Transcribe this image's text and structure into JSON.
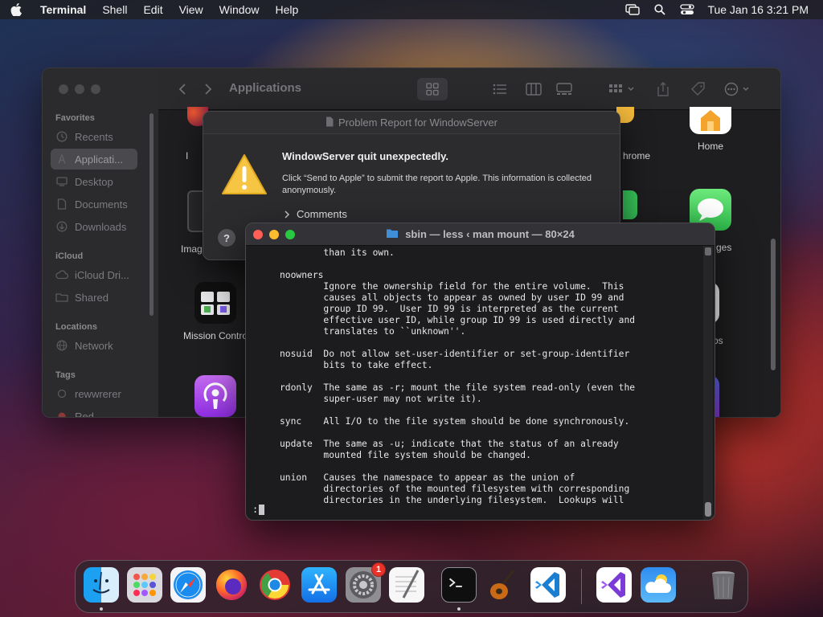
{
  "menubar": {
    "app_name": "Terminal",
    "items": [
      "Shell",
      "Edit",
      "View",
      "Window",
      "Help"
    ],
    "clock": "Tue Jan 16  3:21 PM"
  },
  "finder": {
    "title": "Applications",
    "sidebar": {
      "favorites_header": "Favorites",
      "favorites": [
        "Recents",
        "Applicati...",
        "Desktop",
        "Documents",
        "Downloads"
      ],
      "icloud_header": "iCloud",
      "icloud": [
        "iCloud Dri...",
        "Shared"
      ],
      "locations_header": "Locations",
      "locations": [
        "Network"
      ],
      "tags_header": "Tags",
      "tags": [
        "rewwrerer",
        "Red"
      ]
    },
    "apps": {
      "home": "Home",
      "chrome_partial": "hrome",
      "image_partial": "Imag",
      "messages_partial": "ges",
      "mission_control": "Mission Contro",
      "photos_partial": "os",
      "i_partial": "I"
    }
  },
  "report": {
    "title": "Problem Report for WindowServer",
    "heading": "WindowServer quit unexpectedly.",
    "body": "Click “Send to Apple” to submit the report to Apple. This information is collected anonymously.",
    "comments": "Comments",
    "help": "?"
  },
  "terminal": {
    "title": "sbin — less ‹ man mount — 80×24",
    "lines": [
      "             than its own.",
      "",
      "     noowners",
      "             Ignore the ownership field for the entire volume.  This",
      "             causes all objects to appear as owned by user ID 99 and",
      "             group ID 99.  User ID 99 is interpreted as the current",
      "             effective user ID, while group ID 99 is used directly and",
      "             translates to ``unknown''.",
      "",
      "     nosuid  Do not allow set-user-identifier or set-group-identifier",
      "             bits to take effect.",
      "",
      "     rdonly  The same as -r; mount the file system read-only (even the",
      "             super-user may not write it).",
      "",
      "     sync    All I/O to the file system should be done synchronously.",
      "",
      "     update  The same as -u; indicate that the status of an already",
      "             mounted file system should be changed.",
      "",
      "     union   Causes the namespace to appear as the union of",
      "             directories of the mounted filesystem with corresponding",
      "             directories in the underlying filesystem.  Lookups will"
    ],
    "prompt": ":"
  },
  "dock": {
    "apps": [
      "Finder",
      "Launchpad",
      "Safari",
      "Firefox",
      "Chrome",
      "App Store",
      "System Settings",
      "TextEdit",
      "Terminal",
      "GarageBand",
      "Visual Studio Code",
      "Visual Studio",
      "Weather",
      "Trash"
    ],
    "settings_badge": "1"
  },
  "colors": {
    "accent_red": "#ff5f57",
    "accent_yellow": "#febc2e",
    "accent_green": "#28c840",
    "badge": "#e8332a"
  }
}
